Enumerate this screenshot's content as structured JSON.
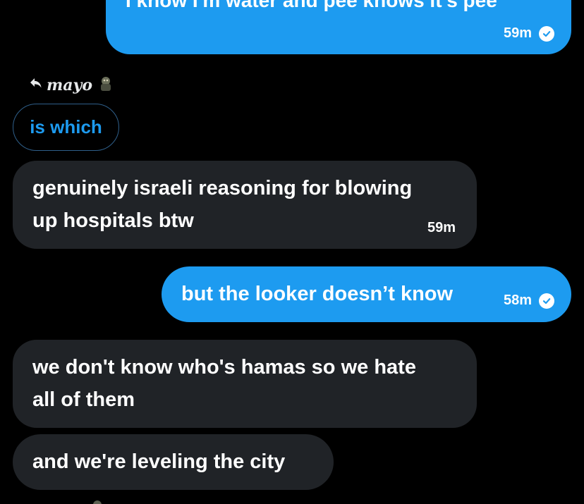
{
  "messages": [
    {
      "id": "msg1",
      "direction": "outgoing",
      "text": "I know I'm water and pee knows it's pee",
      "time": "59m",
      "read": true
    },
    {
      "id": "reply",
      "reply_to_name": "mayo",
      "quoted_text": "is which"
    },
    {
      "id": "msg2",
      "direction": "incoming",
      "lines": [
        "genuinely israeli reasoning for blowing",
        "up hospitals btw"
      ],
      "time": "59m"
    },
    {
      "id": "msg3",
      "direction": "outgoing",
      "text": "but the looker doesn’t know",
      "time": "58m",
      "read": true
    },
    {
      "id": "msg4",
      "direction": "incoming",
      "lines": [
        "we don't know who's hamas so we hate",
        "all of them"
      ]
    },
    {
      "id": "msg5",
      "direction": "incoming",
      "text": "and we're leveling the city"
    }
  ],
  "colors": {
    "background": "#000000",
    "outgoing_bubble": "#1d9bf0",
    "incoming_bubble": "#202327",
    "quote_border": "#2f5f8a",
    "quote_text": "#1d9bf0"
  },
  "icons": {
    "reply": "reply-arrow-icon",
    "read_receipt": "check-circle-icon",
    "avatar": "avatar-icon"
  }
}
